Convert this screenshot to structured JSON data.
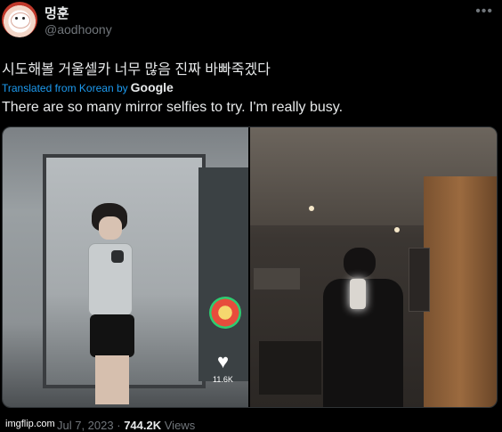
{
  "tweet": {
    "display_name": "멍훈",
    "handle": "@aodhoony",
    "more_icon": "more-icon",
    "text_original": "시도해볼 거울셀카 너무 많음 진짜 바빠죽겠다",
    "translation_label": "Translated from Korean by",
    "translation_provider": "Google",
    "text_translated": "There are so many mirror selfies to try. I'm really busy.",
    "meta_date": "Jul 7, 2023",
    "meta_separator": "·",
    "meta_views_count": "744.2K",
    "meta_views_label": "Views"
  },
  "media": {
    "left_photo": {
      "like_count": "11.6K"
    }
  },
  "watermark": "imgflip.com",
  "colors": {
    "background": "#000000",
    "text": "#e7e9ea",
    "muted": "#71767b",
    "link": "#1d9bf0"
  }
}
